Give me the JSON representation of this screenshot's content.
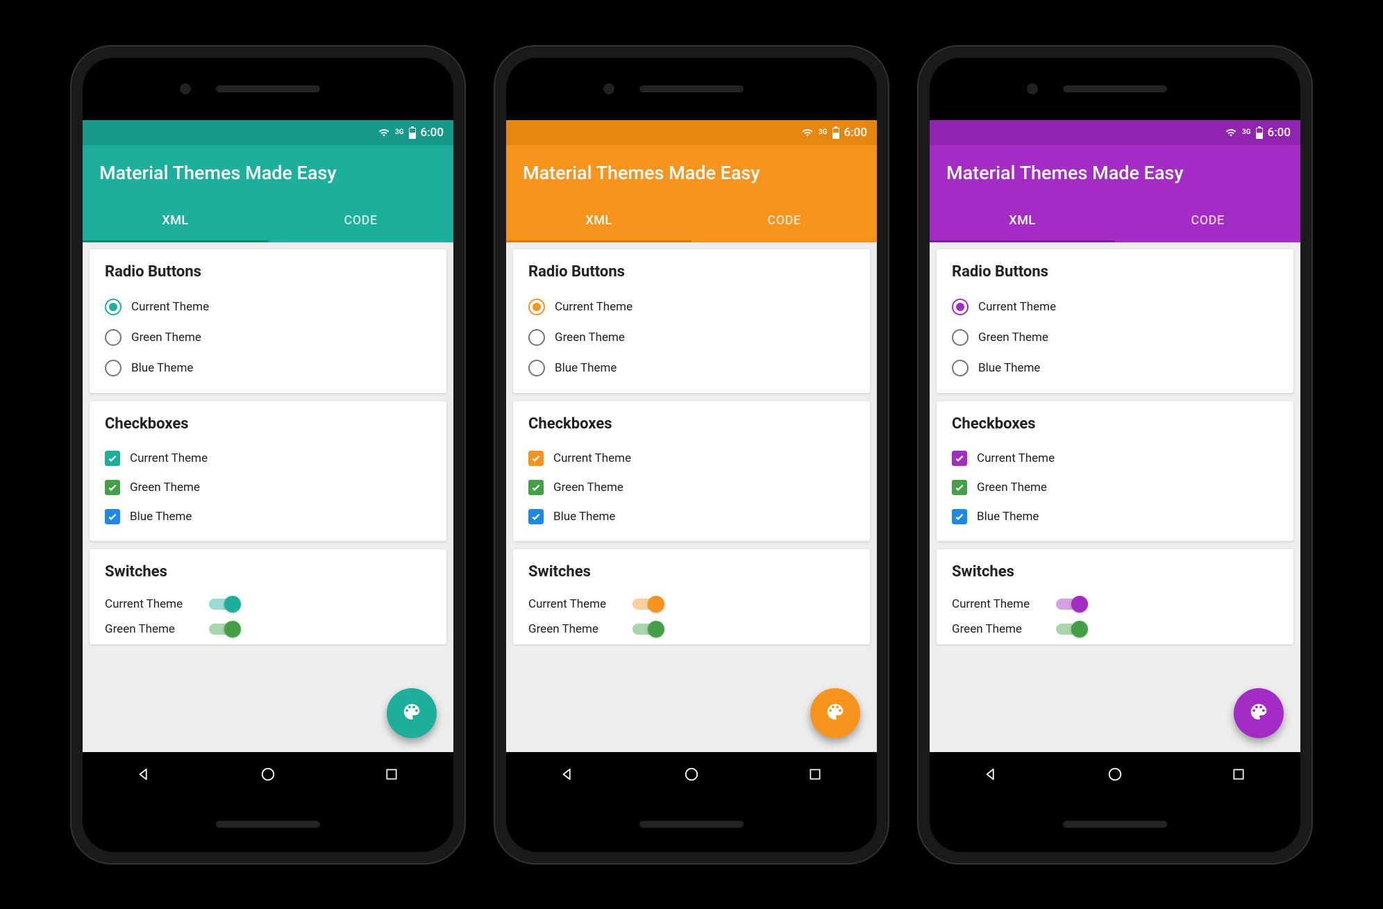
{
  "status": {
    "time": "6:00",
    "net": "3G"
  },
  "app": {
    "title": "Material Themes Made Easy",
    "tabs": [
      {
        "label": "XML",
        "active": true
      },
      {
        "label": "CODE",
        "active": false
      }
    ]
  },
  "sections": {
    "radio": {
      "title": "Radio Buttons",
      "items": [
        {
          "label": "Current Theme",
          "checked": true,
          "color": "accent"
        },
        {
          "label": "Green Theme",
          "checked": false,
          "color": "#757575"
        },
        {
          "label": "Blue Theme",
          "checked": false,
          "color": "#757575"
        }
      ]
    },
    "checkbox": {
      "title": "Checkboxes",
      "items": [
        {
          "label": "Current Theme",
          "checked": true,
          "color": "accent"
        },
        {
          "label": "Green Theme",
          "checked": true,
          "color": "#43A047"
        },
        {
          "label": "Blue Theme",
          "checked": true,
          "color": "#1E88E5"
        }
      ]
    },
    "switches": {
      "title": "Switches",
      "items": [
        {
          "label": "Current Theme",
          "on": true,
          "color": "accent"
        },
        {
          "label": "Green Theme",
          "on": true,
          "color": "#43A047"
        }
      ]
    }
  },
  "phones": [
    {
      "accent": "#1EAF9C",
      "accentDark": "#17998A",
      "tabIndicator": "#1EAF9C"
    },
    {
      "accent": "#F6941E",
      "accentDark": "#E8870F",
      "tabIndicator": "#F6941E"
    },
    {
      "accent": "#A32CC4",
      "accentDark": "#9124B0",
      "tabIndicator": "#A32CC4"
    }
  ],
  "colors": {
    "green": "#43A047",
    "blue": "#1E88E5"
  }
}
